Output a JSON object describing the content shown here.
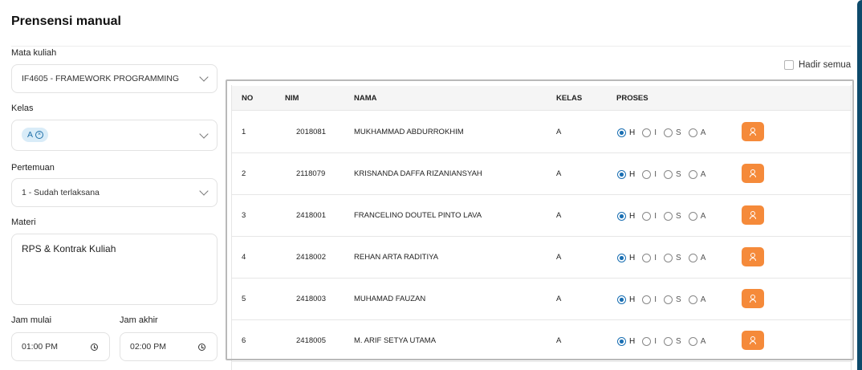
{
  "page_title": "Prensensi manual",
  "form": {
    "mata_kuliah": {
      "label": "Mata kuliah",
      "value": "IF4605 - FRAMEWORK PROGRAMMING"
    },
    "kelas": {
      "label": "Kelas",
      "chip": "A"
    },
    "pertemuan": {
      "label": "Pertemuan",
      "value": "1 - Sudah terlaksana"
    },
    "materi": {
      "label": "Materi",
      "value": "RPS & Kontrak Kuliah"
    },
    "jam_mulai": {
      "label": "Jam mulai",
      "value": "01:00 PM"
    },
    "jam_akhir": {
      "label": "Jam akhir",
      "value": "02:00 PM"
    }
  },
  "hadir_semua": {
    "label": "Hadir semua",
    "checked": false
  },
  "table": {
    "headers": {
      "no": "NO",
      "nim": "NIM",
      "nama": "NAMA",
      "kelas": "KELAS",
      "proses": "PROSES"
    },
    "status_options": [
      "H",
      "I",
      "S",
      "A"
    ],
    "rows": [
      {
        "no": "1",
        "nim": "2018081",
        "nama": "MUKHAMMAD ABDURROKHIM",
        "kelas": "A",
        "status": "H"
      },
      {
        "no": "2",
        "nim": "2118079",
        "nama": "KRISNANDA DAFFA RIZANIANSYAH",
        "kelas": "A",
        "status": "H"
      },
      {
        "no": "3",
        "nim": "2418001",
        "nama": "FRANCELINO DOUTEL PINTO LAVA",
        "kelas": "A",
        "status": "H"
      },
      {
        "no": "4",
        "nim": "2418002",
        "nama": "REHAN ARTA RADITIYA",
        "kelas": "A",
        "status": "H"
      },
      {
        "no": "5",
        "nim": "2418003",
        "nama": "MUHAMAD FAUZAN",
        "kelas": "A",
        "status": "H"
      },
      {
        "no": "6",
        "nim": "2418005",
        "nama": "M. ARIF SETYA UTAMA",
        "kelas": "A",
        "status": "H"
      }
    ]
  },
  "colors": {
    "accent": "#f58a3a",
    "radio": "#1a6fb3",
    "chip_bg": "#d9ecf8",
    "edge": "#0d4a6b"
  },
  "icons": {
    "dropdown": "chevron-down-icon",
    "clear_chip": "close-circle-icon",
    "time": "clock-icon",
    "row_action": "user-icon"
  }
}
